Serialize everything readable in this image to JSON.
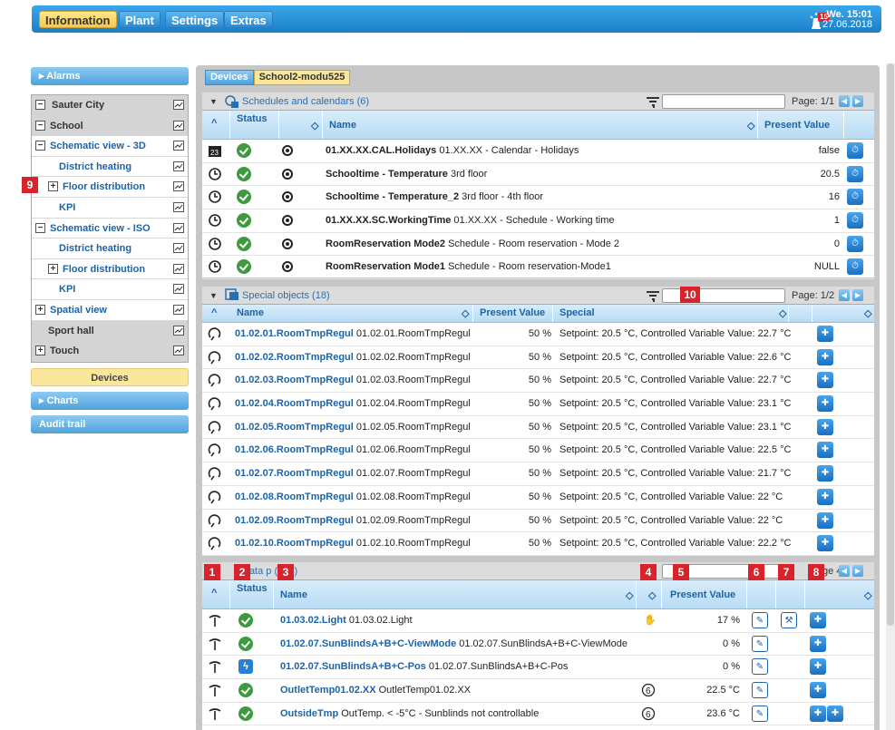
{
  "topbar": {
    "menu": [
      "Information",
      "Plant",
      "Settings",
      "Extras"
    ],
    "alarm_count": "15",
    "clock_day": "We. 15:01",
    "clock_date": "27.06.2018"
  },
  "sidebar": {
    "alarms": "Alarms",
    "tree": [
      {
        "label": "Sauter City",
        "pm": "−",
        "level": 0,
        "grey": true
      },
      {
        "label": "School",
        "pm": "−",
        "level": 0,
        "grey": true
      },
      {
        "label": "Schematic view - 3D",
        "pm": "−",
        "level": 0
      },
      {
        "label": "District heating",
        "pm": "",
        "level": 1
      },
      {
        "label": "Floor distribution",
        "pm": "+",
        "level": 1
      },
      {
        "label": "KPI",
        "pm": "",
        "level": 1
      },
      {
        "label": "Schematic view - ISO",
        "pm": "−",
        "level": 0
      },
      {
        "label": "District heating",
        "pm": "",
        "level": 1
      },
      {
        "label": "Floor distribution",
        "pm": "+",
        "level": 1
      },
      {
        "label": "KPI",
        "pm": "",
        "level": 1
      },
      {
        "label": "Spatial view",
        "pm": "+",
        "level": 0
      },
      {
        "label": "Sport hall",
        "pm": "",
        "level": 0,
        "grey": true
      },
      {
        "label": "Touch",
        "pm": "+",
        "level": 0,
        "grey": true
      }
    ],
    "devices": "Devices",
    "charts": "Charts",
    "audit": "Audit trail"
  },
  "crumbs": [
    "Devices",
    "School2-modu525"
  ],
  "schedules": {
    "title": "Schedules and calendars (6)",
    "page": "Page: 1/1",
    "cols": {
      "status": "Status",
      "name": "Name",
      "present": "Present Value"
    },
    "rows": [
      {
        "bold": "01.XX.XX.CAL.Holidays",
        "rest": " 01.XX.XX - Calendar - Holidays",
        "value": "false",
        "kind": "cal"
      },
      {
        "bold": "Schooltime - Temperature",
        "rest": " 3rd floor",
        "value": "20.5",
        "kind": "clock"
      },
      {
        "bold": "Schooltime - Temperature_2",
        "rest": " 3rd floor - 4th floor",
        "value": "16",
        "kind": "clock"
      },
      {
        "bold": "01.XX.XX.SC.WorkingTime",
        "rest": " 01.XX.XX - Schedule - Working time",
        "value": "1",
        "kind": "clock"
      },
      {
        "bold": "RoomReservation Mode2",
        "rest": " Schedule - Room reservation - Mode 2",
        "value": "0",
        "kind": "clock"
      },
      {
        "bold": "RoomReservation Mode1",
        "rest": " Schedule - Room reservation-Mode1",
        "value": "NULL",
        "kind": "clock"
      }
    ]
  },
  "special": {
    "title": "Special objects (18)",
    "page": "Page: 1/2",
    "cols": {
      "name": "Name",
      "present": "Present Value",
      "special": "Special"
    },
    "rows": [
      {
        "bold": "01.02.01.RoomTmpRegul",
        "rest": " 01.02.01.RoomTmpRegul",
        "value": "50 %",
        "special": "Setpoint: 20.5 °C, Controlled Variable Value: 22.7 °C"
      },
      {
        "bold": "01.02.02.RoomTmpRegul",
        "rest": " 01.02.02.RoomTmpRegul",
        "value": "50 %",
        "special": "Setpoint: 20.5 °C, Controlled Variable Value: 22.6 °C"
      },
      {
        "bold": "01.02.03.RoomTmpRegul",
        "rest": " 01.02.03.RoomTmpRegul",
        "value": "50 %",
        "special": "Setpoint: 20.5 °C, Controlled Variable Value: 22.7 °C"
      },
      {
        "bold": "01.02.04.RoomTmpRegul",
        "rest": " 01.02.04.RoomTmpRegul",
        "value": "50 %",
        "special": "Setpoint: 20.5 °C, Controlled Variable Value: 23.1 °C"
      },
      {
        "bold": "01.02.05.RoomTmpRegul",
        "rest": " 01.02.05.RoomTmpRegul",
        "value": "50 %",
        "special": "Setpoint: 20.5 °C, Controlled Variable Value: 23.1 °C"
      },
      {
        "bold": "01.02.06.RoomTmpRegul",
        "rest": " 01.02.06.RoomTmpRegul",
        "value": "50 %",
        "special": "Setpoint: 20.5 °C, Controlled Variable Value: 22.5 °C"
      },
      {
        "bold": "01.02.07.RoomTmpRegul",
        "rest": " 01.02.07.RoomTmpRegul",
        "value": "50 %",
        "special": "Setpoint: 20.5 °C, Controlled Variable Value: 21.7 °C"
      },
      {
        "bold": "01.02.08.RoomTmpRegul",
        "rest": " 01.02.08.RoomTmpRegul",
        "value": "50 %",
        "special": "Setpoint: 20.5 °C, Controlled Variable Value: 22 °C"
      },
      {
        "bold": "01.02.09.RoomTmpRegul",
        "rest": " 01.02.09.RoomTmpRegul",
        "value": "50 %",
        "special": "Setpoint: 20.5 °C, Controlled Variable Value: 22 °C"
      },
      {
        "bold": "01.02.10.RoomTmpRegul",
        "rest": " 01.02.10.RoomTmpRegul",
        "value": "50 %",
        "special": "Setpoint: 20.5 °C, Controlled Variable Value: 22.2 °C"
      }
    ]
  },
  "datapoints": {
    "title_a": "Data p",
    "title_b": "(334)",
    "page_frag": "ge",
    "page_frag2": "4",
    "cols": {
      "status": "Status",
      "name": "Name",
      "present": "Present Value"
    },
    "rows": [
      {
        "bold": "01.03.02.Light",
        "rest": " 01.03.02.Light",
        "value": "17 %",
        "status": "ok",
        "mid": "hand"
      },
      {
        "bold": "01.02.07.SunBlindsA+B+C-ViewMode",
        "rest": " 01.02.07.SunBlindsA+B+C-ViewMode",
        "value": "0 %",
        "status": "ok",
        "mid": ""
      },
      {
        "bold": "01.02.07.SunBlindsA+B+C-Pos",
        "rest": " 01.02.07.SunBlindsA+B+C-Pos",
        "value": "0 %",
        "status": "bolt",
        "mid": ""
      },
      {
        "bold": "OutletTemp01.02.XX",
        "rest": " OutletTemp01.02.XX",
        "value": "22.5 °C",
        "status": "ok",
        "mid": "6"
      },
      {
        "bold": "OutsideTmp",
        "rest": " OutTemp. < -5°C - Sunblinds not controllable",
        "value": "23.6 °C",
        "status": "ok",
        "mid": "6"
      }
    ]
  },
  "markers": [
    "1",
    "2",
    "3",
    "4",
    "5",
    "6",
    "7",
    "8",
    "9",
    "10"
  ],
  "colors": {
    "accent": "#1d63a6",
    "ok": "#3e9a3e",
    "marker": "#d9232b",
    "topbar": "#1b7fc8"
  }
}
